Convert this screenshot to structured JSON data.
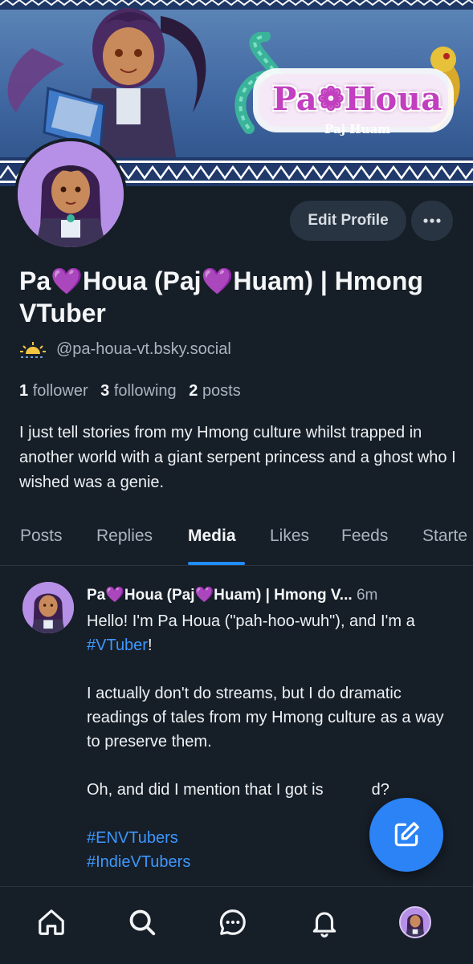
{
  "banner": {
    "logo_title": "Pa❁Houa",
    "logo_subtitle": "Paj Huam"
  },
  "profile": {
    "display_name": "Pa💜Houa (Paj💜Huam) | Hmong VTuber",
    "handle": "@pa-houa-vt.bsky.social",
    "stats": {
      "followers_count": "1",
      "followers_label": "follower",
      "following_count": "3",
      "following_label": "following",
      "posts_count": "2",
      "posts_label": "posts"
    },
    "bio": "I just tell stories from my Hmong culture whilst trapped in another world with a giant serpent princess and a ghost who I wished was a genie."
  },
  "actions": {
    "edit_profile_label": "Edit Profile",
    "more_icon": "ellipsis-icon"
  },
  "tabs": [
    {
      "label": "Posts",
      "active": false
    },
    {
      "label": "Replies",
      "active": false
    },
    {
      "label": "Media",
      "active": true
    },
    {
      "label": "Likes",
      "active": false
    },
    {
      "label": "Feeds",
      "active": false
    },
    {
      "label": "Starte",
      "active": false
    }
  ],
  "post": {
    "author": "Pa💜Houa (Paj💜Huam) | Hmong V...",
    "time": "6m",
    "line1_pre": "Hello! I'm Pa Houa (\"pah-hoo-wuh\"), and I'm a ",
    "line1_tag": "#VTuber",
    "line1_post": "!",
    "para2": "I actually don't do streams, but I do dramatic readings of tales from my Hmong culture as a way to preserve them.",
    "para3": "Oh, and did I mention that I got is",
    "para3_end": "d?",
    "tag1": "#ENVTubers",
    "tag2": "#IndieVTubers"
  },
  "colors": {
    "background": "#161e27",
    "accent": "#1f8cff",
    "link": "#3d97ff",
    "fab": "#2b83f6"
  },
  "nav": [
    "home-icon",
    "search-icon",
    "chat-icon",
    "bell-icon",
    "profile-avatar"
  ]
}
